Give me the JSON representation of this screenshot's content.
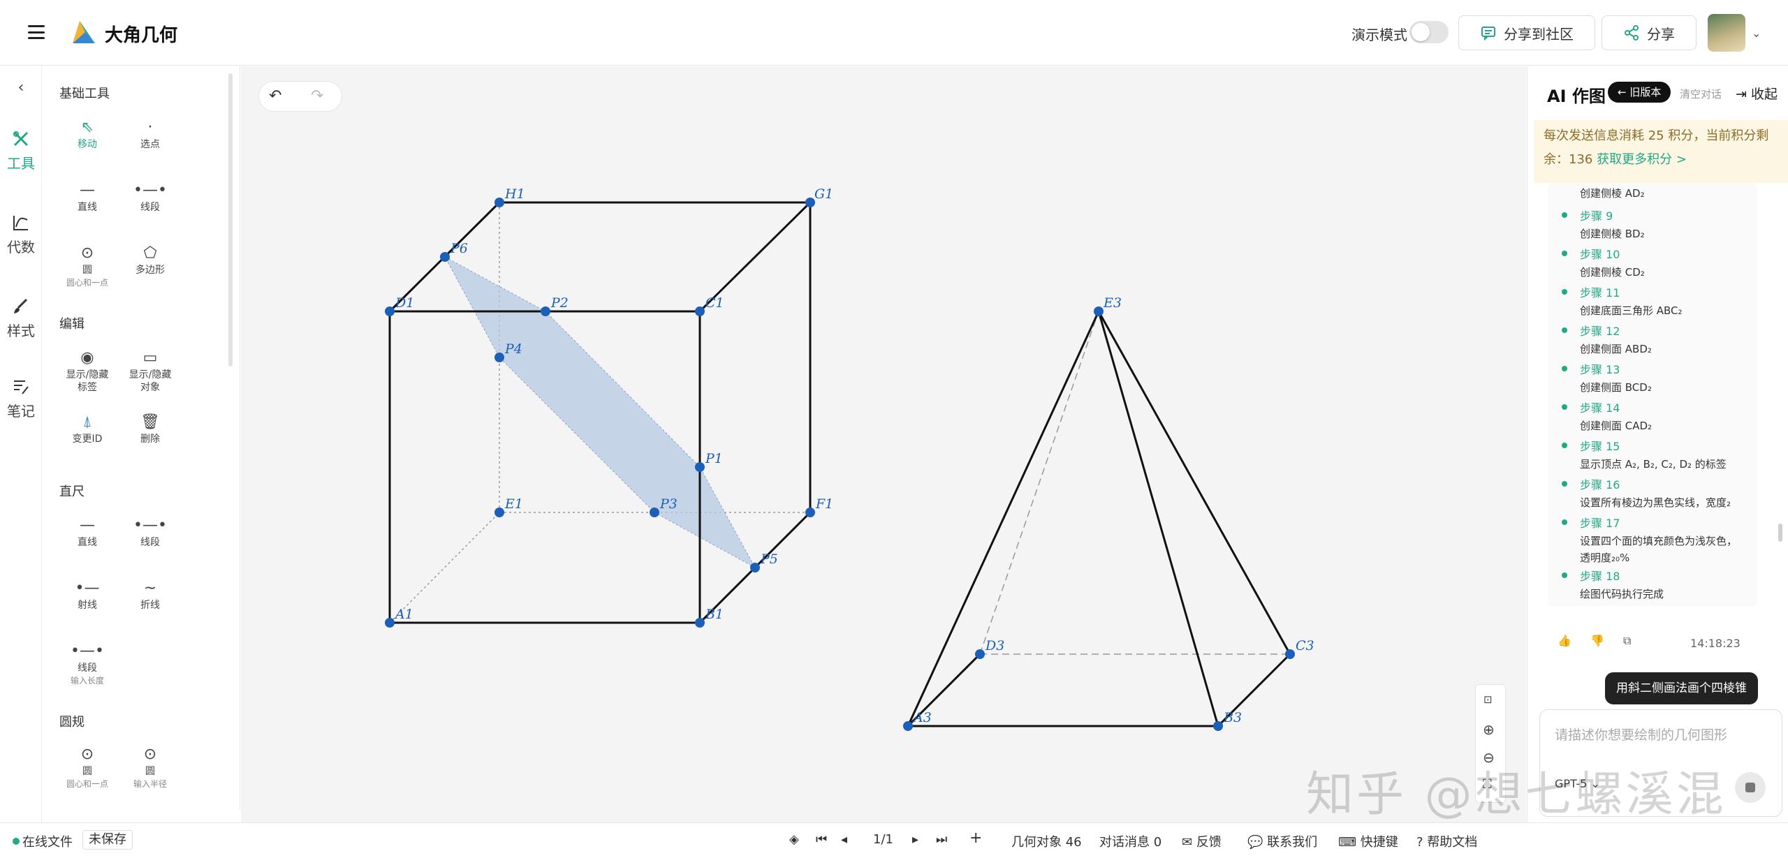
{
  "header": {
    "logo_text": "大角几何",
    "demo_mode_label": "演示模式",
    "share_community_label": "分享到社区",
    "share_label": "分享"
  },
  "rail": {
    "items": [
      {
        "label": "工具",
        "icon": "tools-icon"
      },
      {
        "label": "代数",
        "icon": "algebra-icon"
      },
      {
        "label": "样式",
        "icon": "brush-icon"
      },
      {
        "label": "笔记",
        "icon": "notes-icon"
      }
    ]
  },
  "tools": {
    "sections": {
      "basic": "基础工具",
      "edit": "编辑",
      "ruler": "直尺",
      "compass": "圆规"
    },
    "items": {
      "move": "移动",
      "select_point": "选点",
      "line": "直线",
      "segment": "线段",
      "circle": "圆",
      "circle_sub": "圆心和一点",
      "polygon": "多边形",
      "toggle_label": "显示/隐藏\n标签",
      "toggle_object": "显示/隐藏\n对象",
      "change_id": "变更ID",
      "delete": "删除",
      "ruler_line": "直线",
      "ruler_segment": "线段",
      "ray": "射线",
      "polyline": "折线",
      "seg_length": "线段",
      "seg_length_sub": "输入长度",
      "compass_circle1": "圆",
      "compass_circle1_sub": "圆心和一点",
      "compass_circle2": "圆",
      "compass_circle2_sub": "输入半径"
    }
  },
  "canvas": {
    "cube_points": [
      "H1",
      "G1",
      "P6",
      "D1",
      "P2",
      "C1",
      "P4",
      "P1",
      "E1",
      "F1",
      "P3",
      "P5",
      "A1",
      "B1"
    ],
    "pyramid_points": [
      "E3",
      "D3",
      "C3",
      "A3",
      "B3"
    ]
  },
  "ai": {
    "title": "AI 作图",
    "old_version": "← 旧版本",
    "clear": "清空对话",
    "collapse": "收起",
    "notice_text": "每次发送信息消耗 25 积分，当前积分剩余：136",
    "notice_link": "获取更多积分 >",
    "partial_step": "创建侧棱 AD₂",
    "steps": [
      {
        "title": "步骤 9",
        "desc": "创建侧棱 BD₂"
      },
      {
        "title": "步骤 10",
        "desc": "创建侧棱 CD₂"
      },
      {
        "title": "步骤 11",
        "desc": "创建底面三角形 ABC₂"
      },
      {
        "title": "步骤 12",
        "desc": "创建侧面 ABD₂"
      },
      {
        "title": "步骤 13",
        "desc": "创建侧面 BCD₂"
      },
      {
        "title": "步骤 14",
        "desc": "创建侧面 CAD₂"
      },
      {
        "title": "步骤 15",
        "desc": "显示顶点 A₂, B₂, C₂, D₂ 的标签"
      },
      {
        "title": "步骤 16",
        "desc": "设置所有棱边为黑色实线，宽度₂"
      },
      {
        "title": "步骤 17",
        "desc": "设置四个面的填充颜色为浅灰色，",
        "desc2": "透明度₂₀%"
      },
      {
        "title": "步骤 18",
        "desc": "绘图代码执行完成"
      }
    ],
    "time": "14:18:23",
    "user_message": "用斜二侧画法画个四棱锥",
    "input_placeholder": "请描述你想要绘制的几何图形",
    "model": "GPT-5"
  },
  "watermark": "知乎 @想七螺溪混",
  "status": {
    "online_file": "在线文件",
    "unsaved": "未保存",
    "page": "1/1",
    "objects": "几何对象 46",
    "messages": "对话消息 0",
    "feedback": "反馈",
    "contact": "联系我们",
    "shortcuts": "快捷键",
    "help": "帮助文档"
  }
}
